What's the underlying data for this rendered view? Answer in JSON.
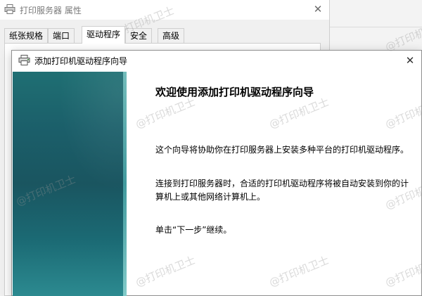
{
  "properties_window": {
    "title": "打印服务器 属性",
    "tabs": [
      "纸张规格",
      "端口",
      "驱动程序",
      "安全",
      "高级"
    ],
    "active_tab": "驱动程序"
  },
  "wizard": {
    "title": "添加打印机驱动程序向导",
    "heading": "欢迎使用添加打印机驱动程序向导",
    "paragraph1": "这个向导将协助你在打印服务器上安装多种平台的打印机驱动程序。",
    "paragraph2": "连接到打印服务器时，合适的打印机驱动程序将被自动安装到你的计算机上或其他网络计算机上。",
    "paragraph3": "单击“下一步”继续。"
  },
  "watermark": "@打印机卫士",
  "icons": {
    "printer": "printer-icon",
    "close": "close-icon"
  }
}
